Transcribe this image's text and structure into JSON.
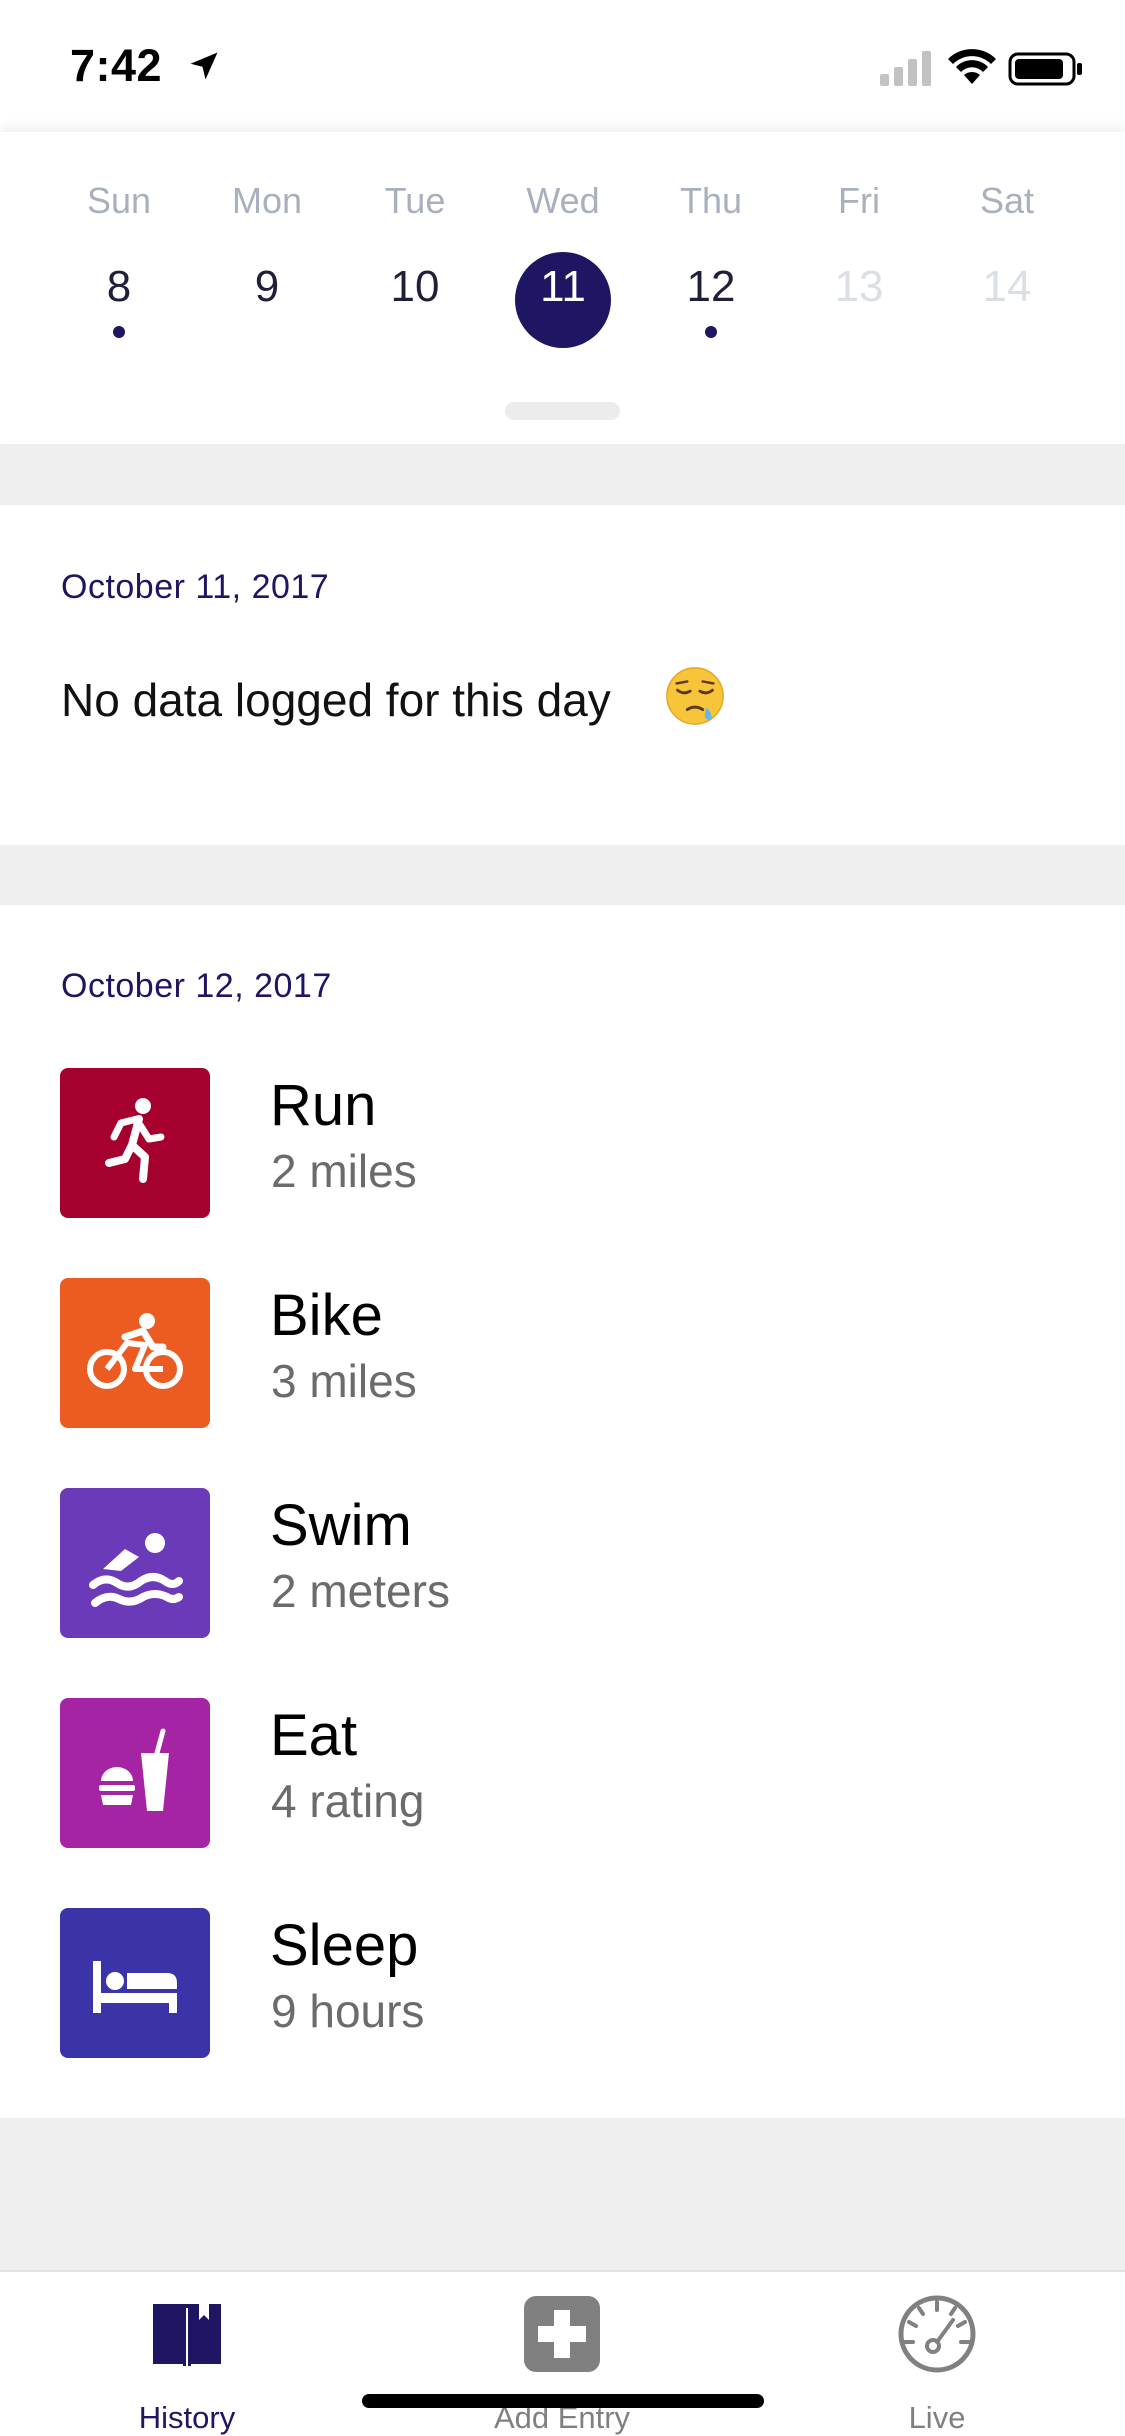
{
  "status_bar": {
    "time": "7:42"
  },
  "week": {
    "days": [
      {
        "name": "Sun",
        "number": "8",
        "has_entries": true,
        "selected": false,
        "future": false
      },
      {
        "name": "Mon",
        "number": "9",
        "has_entries": false,
        "selected": false,
        "future": false
      },
      {
        "name": "Tue",
        "number": "10",
        "has_entries": false,
        "selected": false,
        "future": false
      },
      {
        "name": "Wed",
        "number": "11",
        "has_entries": false,
        "selected": true,
        "future": false
      },
      {
        "name": "Thu",
        "number": "12",
        "has_entries": true,
        "selected": false,
        "future": false
      },
      {
        "name": "Fri",
        "number": "13",
        "has_entries": false,
        "selected": false,
        "future": true
      },
      {
        "name": "Sat",
        "number": "14",
        "has_entries": false,
        "selected": false,
        "future": true
      }
    ]
  },
  "day1": {
    "date": "October 11, 2017",
    "empty_message": "No data logged for this day",
    "emoji": "sleepy-face"
  },
  "day2": {
    "date": "October 12, 2017",
    "activities": [
      {
        "name": "Run",
        "value": "2 miles",
        "icon": "run-icon",
        "color": "#a6002f"
      },
      {
        "name": "Bike",
        "value": "3 miles",
        "icon": "bike-icon",
        "color": "#ec5c22"
      },
      {
        "name": "Swim",
        "value": "2 meters",
        "icon": "swim-icon",
        "color": "#6a3ab8"
      },
      {
        "name": "Eat",
        "value": "4 rating",
        "icon": "eat-icon",
        "color": "#a424a4"
      },
      {
        "name": "Sleep",
        "value": "9 hours",
        "icon": "sleep-icon",
        "color": "#3b33a8"
      }
    ]
  },
  "tab_bar": {
    "tabs": [
      {
        "label": "History",
        "icon": "book-icon",
        "active": true
      },
      {
        "label": "Add Entry",
        "icon": "plus-icon",
        "active": false
      },
      {
        "label": "Live",
        "icon": "speedometer-icon",
        "active": false
      }
    ]
  },
  "colors": {
    "accent": "#1f1663",
    "muted_text": "#a9b0bd",
    "background": "#efefef"
  }
}
